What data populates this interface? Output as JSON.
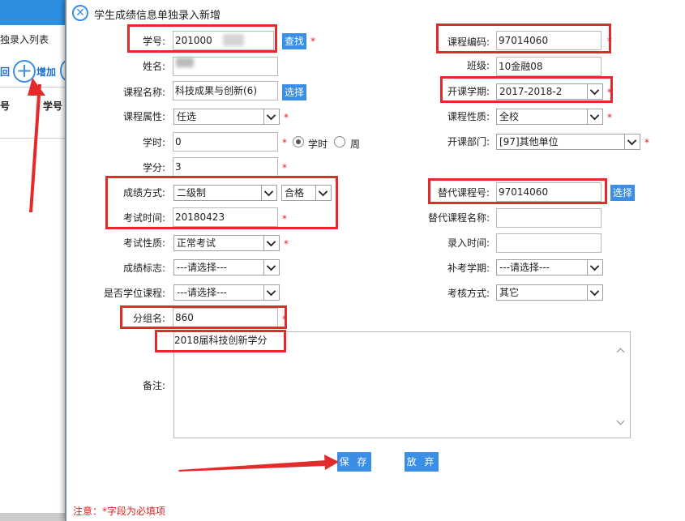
{
  "background": {
    "page_title": "独录入列表",
    "left_cut_label": "回",
    "add_icon": "plus-icon",
    "add_label": "增加",
    "grid_columns": [
      "号",
      "学号"
    ]
  },
  "dialog": {
    "close_icon": "close-icon",
    "title": "学生成绩信息单独录入新增",
    "fields": {
      "student_id": {
        "label": "学号:",
        "value": "201000"
      },
      "find_button": "查找",
      "course_code": {
        "label": "课程编码:",
        "value": "97014060"
      },
      "name": {
        "label": "姓名:",
        "value": ""
      },
      "class": {
        "label": "班级:",
        "value": "10金融08"
      },
      "course_name": {
        "label": "课程名称:",
        "value": "科技成果与创新(6)"
      },
      "select_button": "选择",
      "term": {
        "label": "开课学期:",
        "value": "2017-2018-2"
      },
      "course_attr": {
        "label": "课程属性:",
        "value": "任选"
      },
      "course_nature": {
        "label": "课程性质:",
        "value": "全校"
      },
      "hours": {
        "label": "学时:",
        "value": "0",
        "unit_hours": "学时",
        "unit_weeks": "周"
      },
      "dept": {
        "label": "开课部门:",
        "value": "[97]其他单位"
      },
      "credit": {
        "label": "学分:",
        "value": "3"
      },
      "grade_method": {
        "label": "成绩方式:",
        "value": "二级制",
        "grade_value": "合格"
      },
      "substitute_code": {
        "label": "替代课程号:",
        "value": "97014060"
      },
      "substitute_select_button": "选择",
      "exam_time": {
        "label": "考试时间:",
        "value": "20180423"
      },
      "substitute_name": {
        "label": "替代课程名称:",
        "value": ""
      },
      "exam_nature": {
        "label": "考试性质:",
        "value": "正常考试"
      },
      "entry_time": {
        "label": "录入时间:",
        "value": ""
      },
      "grade_flag": {
        "label": "成绩标志:",
        "value": "---请选择---"
      },
      "makeup_term": {
        "label": "补考学期:",
        "value": "---请选择---"
      },
      "degree_course": {
        "label": "是否学位课程:",
        "value": "---请选择---"
      },
      "assessment": {
        "label": "考核方式:",
        "value": "其它"
      },
      "group_name": {
        "label": "分组名:",
        "value": "860"
      },
      "remark": {
        "label": "备注:",
        "value": "2018届科技创新学分"
      }
    },
    "required_mark": "*",
    "save_button": "保 存",
    "cancel_button": "放 弃",
    "footer_note": "注意：*字段为必填项"
  },
  "colors": {
    "accent": "#3a8ee6",
    "highlight": "#e32b2b",
    "required": "#e02020"
  }
}
